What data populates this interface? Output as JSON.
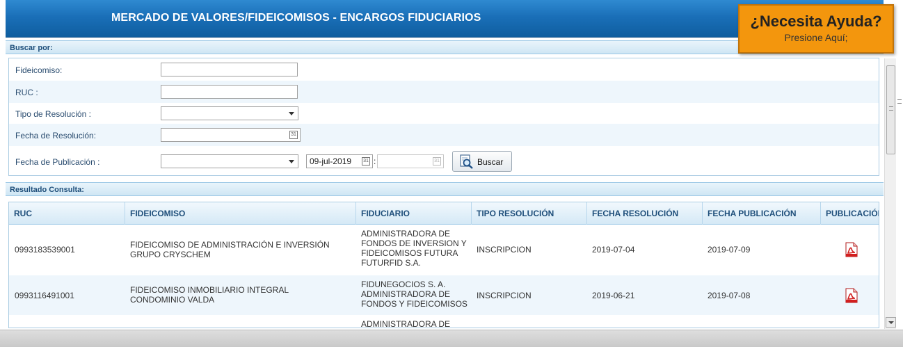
{
  "header": {
    "title": "MERCADO DE VALORES/FIDEICOMISOS - ENCARGOS FIDUCIARIOS"
  },
  "help": {
    "title": "¿Necesita Ayuda?",
    "subtitle": "Presione Aquí;"
  },
  "search": {
    "section_label": "Buscar por:",
    "fields": {
      "fideicomiso_label": "Fideicomiso:",
      "fideicomiso_value": "",
      "ruc_label": "RUC :",
      "ruc_value": "",
      "tipo_resolucion_label": "Tipo de Resolución :",
      "tipo_resolucion_value": "",
      "fecha_resolucion_label": "Fecha de Resolución:",
      "fecha_resolucion_value": "",
      "fecha_publicacion_label": "Fecha de Publicación :",
      "fecha_publicacion_operator": "",
      "fecha_publicacion_from": "09-jul-2019",
      "fecha_publicacion_separator": ":",
      "fecha_publicacion_to": ""
    },
    "button_label": "Buscar",
    "calendar_icon_text": "31"
  },
  "results": {
    "section_label": "Resultado Consulta:",
    "columns": [
      "RUC",
      "FIDEICOMISO",
      "FIDUCIARIO",
      "TIPO RESOLUCIÓN",
      "FECHA RESOLUCIÓN",
      "FECHA PUBLICACIÓN",
      "PUBLICACIÓN"
    ],
    "rows": [
      {
        "ruc": "0993183539001",
        "fideicomiso": "FIDEICOMISO DE ADMINISTRACIÓN E INVERSIÓN GRUPO CRYSCHEM",
        "fiduciario": "ADMINISTRADORA DE FONDOS DE INVERSION Y FIDEICOMISOS FUTURA FUTURFID S.A.",
        "tipo": "INSCRIPCION",
        "fecha_resolucion": "2019-07-04",
        "fecha_publicacion": "2019-07-09",
        "publicacion_icon": "pdf-icon"
      },
      {
        "ruc": "0993116491001",
        "fideicomiso": "FIDEICOMISO INMOBILIARIO INTEGRAL CONDOMINIO VALDA",
        "fiduciario": "FIDUNEGOCIOS S. A. ADMINISTRADORA DE FONDOS Y FIDEICOMISOS",
        "tipo": "INSCRIPCION",
        "fecha_resolucion": "2019-06-21",
        "fecha_publicacion": "2019-07-08",
        "publicacion_icon": "pdf-icon"
      },
      {
        "ruc": "",
        "fideicomiso": "",
        "fiduciario": "ADMINISTRADORA DE",
        "tipo": "",
        "fecha_resolucion": "",
        "fecha_publicacion": "",
        "publicacion_icon": ""
      }
    ]
  },
  "colors": {
    "title_bar": "#1a6fb8",
    "help_box": "#f3960d",
    "section_text": "#1e4e7a",
    "alt_row": "#eef6fc",
    "pdf_red": "#d21f1f"
  }
}
